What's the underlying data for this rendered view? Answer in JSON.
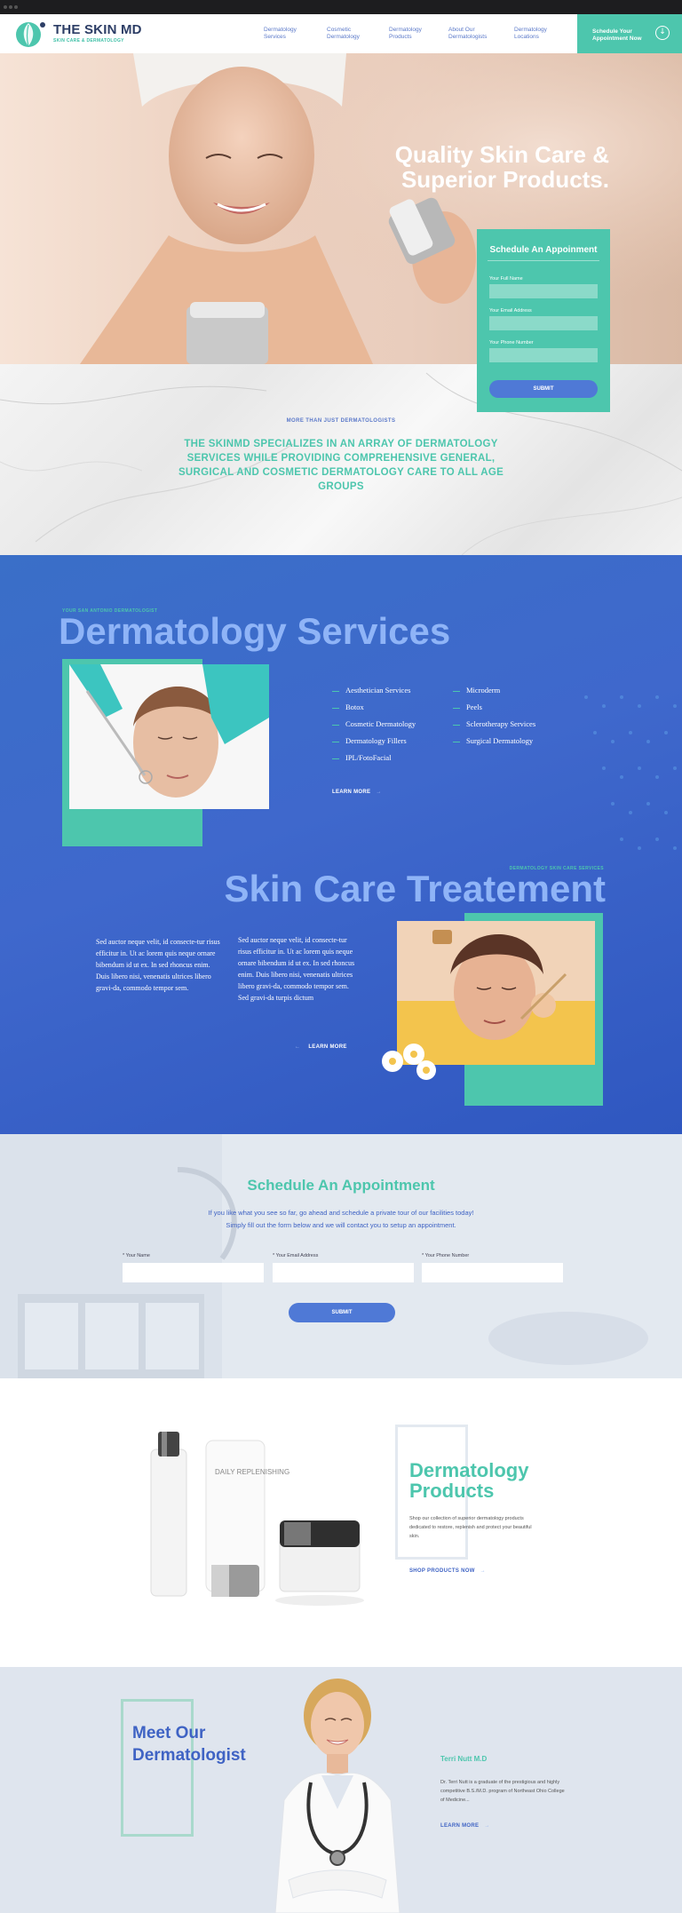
{
  "header": {
    "logo_title": "THE SKIN MD",
    "logo_subtitle": "SKIN CARE & DERMATOLOGY",
    "nav": [
      {
        "line1": "Dermatology",
        "line2": "Services"
      },
      {
        "line1": "Cosmetic",
        "line2": "Dermatology"
      },
      {
        "line1": "Dermatology",
        "line2": "Products"
      },
      {
        "line1": "About Our",
        "line2": "Dermatologists"
      },
      {
        "line1": "Dermatology",
        "line2": "Locations"
      }
    ],
    "cta_line1": "Schedule Your",
    "cta_line2": "Appointment Now",
    "cta_icon": "arrow-down-circle-icon"
  },
  "hero": {
    "title_line1": "Quality Skin Care &",
    "title_line2": "Superior Products."
  },
  "hero_form": {
    "title": "Schedule An Appoinment",
    "name_label": "Your Full Name",
    "email_label": "Your Email Address",
    "phone_label": "Your Phone Number",
    "submit": "SUBMIT"
  },
  "intro": {
    "kicker": "MORE THAN JUST DERMATOLOGISTS",
    "text": "THE SKINMD SPECIALIZES IN AN ARRAY OF DERMATOLOGY SERVICES WHILE PROVIDING  COMPREHENSIVE GENERAL, SURGICAL AND COSMETIC DERMATOLOGY CARE TO ALL AGE GROUPS"
  },
  "services": {
    "kicker": "YOUR SAN ANTONIO DERMATOLOGIST",
    "title": "Dermatology Services",
    "col1": [
      "Aesthetician Services",
      "Botox",
      "Cosmetic Dermatology",
      "Dermatology Fillers",
      "IPL/FotoFacial"
    ],
    "col2": [
      "Microderm",
      "Peels",
      "Sclerotherapy Services",
      "Surgical Dermatology"
    ],
    "learn_more": "LEARN MORE",
    "arrow": "→"
  },
  "skin_care": {
    "kicker": "DERMATOLOGY SKIN CARE SERVICES",
    "title": "Skin Care Treatement",
    "para1": "Sed auctor neque velit, id consecte-tur risus efficitur in. Ut ac lorem quis neque ornare bibendum id ut ex. In sed rhoncus enim. Duis libero nisi, venenatis ultrices libero gravi-da, commodo tempor sem.",
    "para2": "Sed auctor neque velit, id consecte-tur risus efficitur in. Ut ac lorem quis neque ornare bibendum id ut ex. In sed rhoncus enim. Duis libero nisi, venenatis ultrices libero gravi-da, commodo tempor sem. Sed gravi-da turpis dictum",
    "learn_more": "LEARN MORE",
    "arrow": "←"
  },
  "appointment": {
    "title": "Schedule An Appointment",
    "sub_line1": "If you like what you see so far, go ahead and schedule a private tour of our facilities today!",
    "sub_line2": "Simply fill out the form below and we will contact you to setup an appointment.",
    "name_label": "* Your Name",
    "email_label": "* Your Email Address",
    "phone_label": "* Your Phone Number",
    "submit": "SUBMIT"
  },
  "products": {
    "title_line1": "Dermatology",
    "title_line2": "Products",
    "text": "Shop our collection of superior dermatology products dedicated to restore, replenish and protect your beautiful skin.",
    "link": "SHOP PRODUCTS NOW",
    "arrow": "→",
    "jar_label": "DAILY REPLENISHING"
  },
  "dermatologist": {
    "title_line1": "Meet Our",
    "title_line2": "Dermatologist",
    "name": "Terri Nutt M.D",
    "text": "Dr. Terri Nutt is a graduate of the prestigious and highly competitive B.S./M.D. program of Northeast Ohio College of Medicine...",
    "link": "LEARN MORE",
    "arrow": "→"
  },
  "colors": {
    "teal": "#4dc6ad",
    "blue": "#3f63c4",
    "light_blue": "#8fb4f7",
    "navy": "#2d3e66"
  }
}
